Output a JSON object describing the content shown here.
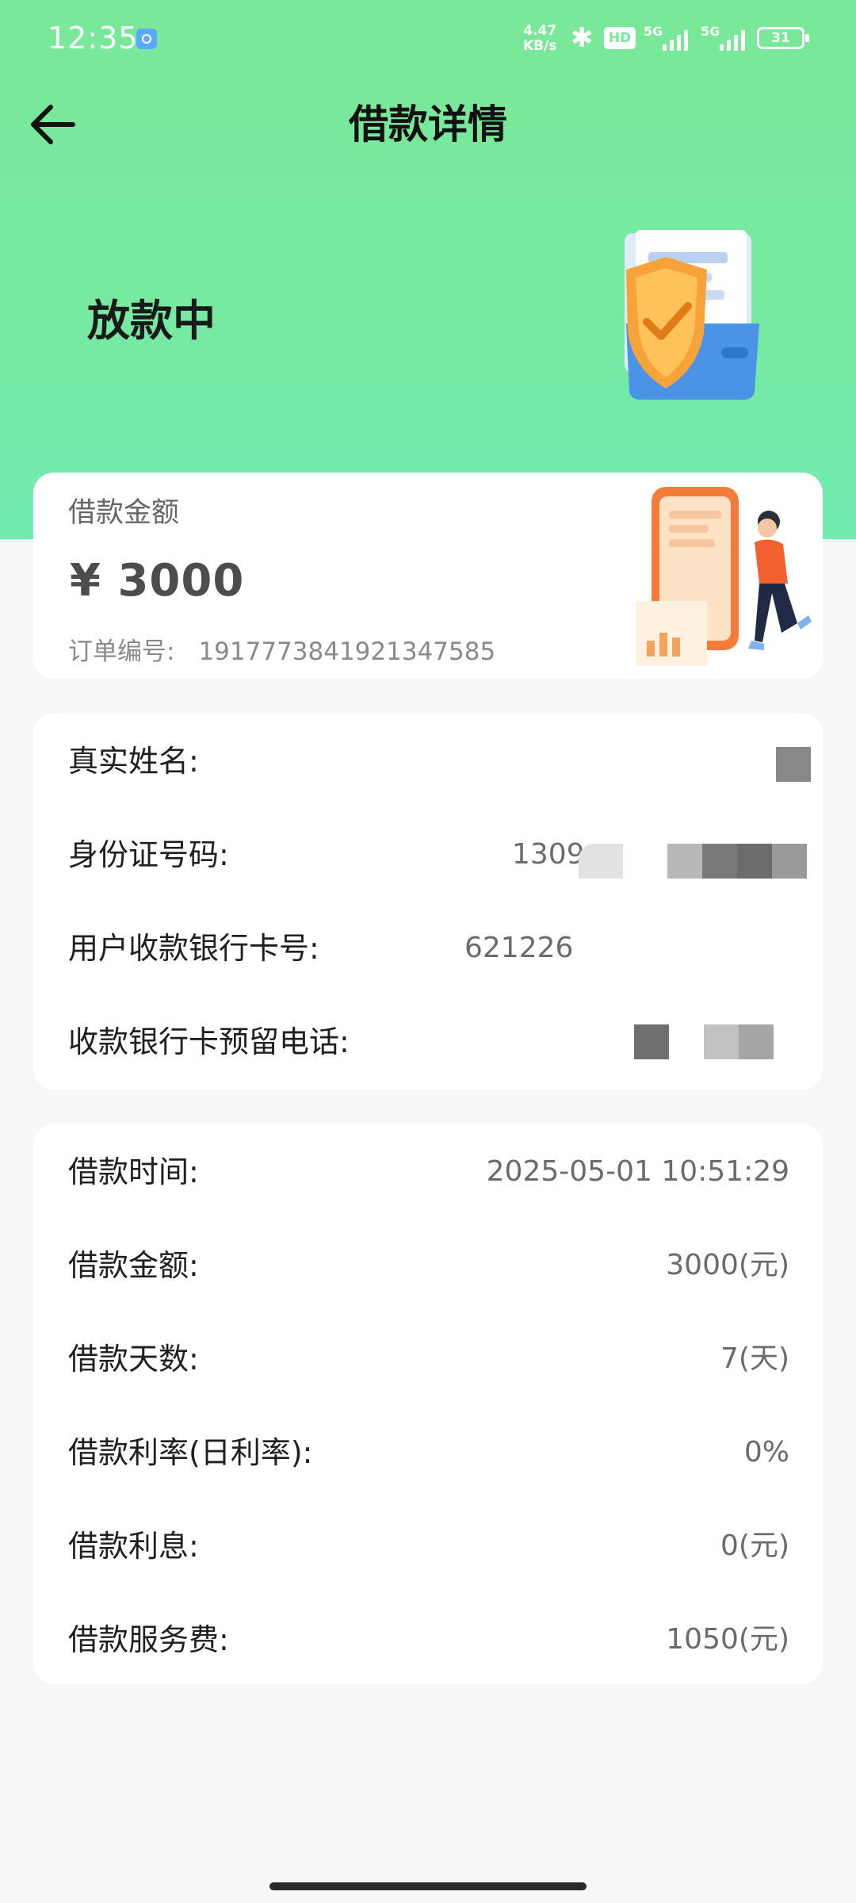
{
  "status_bar": {
    "time": "12:35",
    "net_speed_value": "4.47",
    "net_speed_unit": "KB/s",
    "bluetooth_icon": "bluetooth-icon",
    "hd_badge": "HD",
    "signal1_label": "5G",
    "signal2_label": "5G",
    "battery": "31"
  },
  "header": {
    "title": "借款详情",
    "back_icon": "arrow-left-icon"
  },
  "hero": {
    "status": "放款中",
    "illustration": "shield-folder-illustration"
  },
  "summary_card": {
    "label": "借款金额",
    "amount": "¥ 3000",
    "order_label": "订单编号:",
    "order_number": "1917773841921347585",
    "illustration": "phone-receipt-person-illustration"
  },
  "personal_info": {
    "rows": [
      {
        "label": "真实姓名:",
        "value": ""
      },
      {
        "label": "身份证号码:",
        "value": "1309"
      },
      {
        "label": "用户收款银行卡号:",
        "value": "621226"
      },
      {
        "label": "收款银行卡预留电话:",
        "value": ""
      }
    ]
  },
  "loan_info": {
    "rows": [
      {
        "label": "借款时间:",
        "value": "2025-05-01 10:51:29"
      },
      {
        "label": "借款金额:",
        "value": "3000(元)"
      },
      {
        "label": "借款天数:",
        "value": "7(天)"
      },
      {
        "label": "借款利率(日利率):",
        "value": "0%"
      },
      {
        "label": "借款利息:",
        "value": "0(元)"
      },
      {
        "label": "借款服务费:",
        "value": "1050(元)"
      }
    ]
  },
  "colors": {
    "hero_green": "#77e99e",
    "card_bg": "#ffffff",
    "page_bg": "#f7f7f7"
  }
}
